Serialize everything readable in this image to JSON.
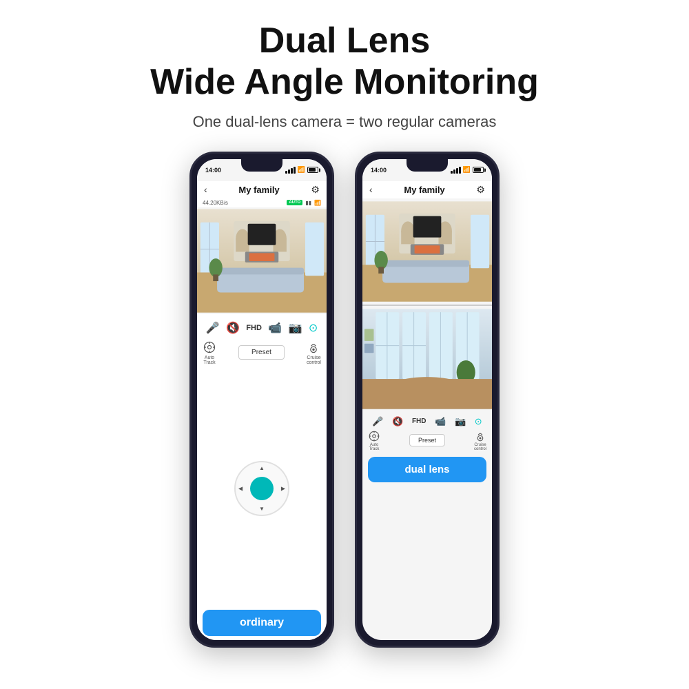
{
  "header": {
    "headline_line1": "Dual Lens",
    "headline_line2": "Wide Angle Monitoring",
    "subtitle": "One dual-lens camera = two regular cameras"
  },
  "phone_left": {
    "status_time": "14:00",
    "nav_title": "My family",
    "toolbar_speed": "44.20KB/s",
    "auto_badge": "AUTO",
    "bottom_label": "ordinary",
    "track_label": "Auto\nTrack",
    "cruise_label": "Cruise\ncontrol",
    "preset_label": "Preset",
    "icons": [
      "mic",
      "mute",
      "FHD",
      "record",
      "camera",
      "settings"
    ]
  },
  "phone_right": {
    "status_time": "14:00",
    "nav_title": "My family",
    "bottom_label": "dual lens",
    "track_label": "Auto\nTrack",
    "cruise_label": "Cruise\ncontrol",
    "preset_label": "Preset",
    "icons": [
      "mic",
      "mute",
      "FHD",
      "record",
      "camera",
      "settings"
    ],
    "track_bottom": "Track"
  }
}
